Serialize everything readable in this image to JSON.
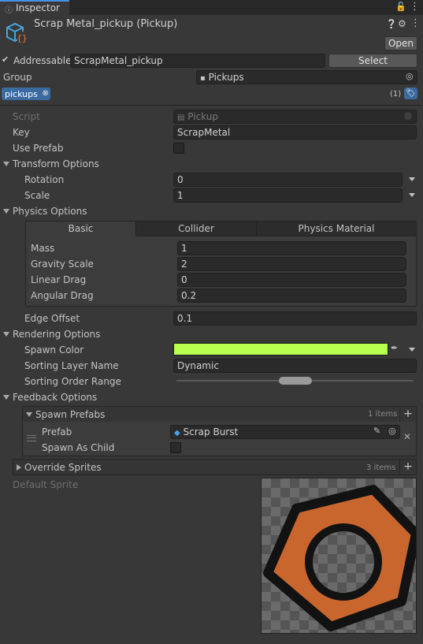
{
  "tab": {
    "label": "Inspector"
  },
  "header": {
    "title": "Scrap Metal_pickup (Pickup)",
    "open_label": "Open"
  },
  "addressable": {
    "label": "Addressable",
    "address": "ScrapMetal_pickup",
    "select_label": "Select",
    "group_label": "Group",
    "group_value": "Pickups",
    "tag": "pickups",
    "tag_count": "(1)"
  },
  "fields": {
    "script_label": "Script",
    "script_value": "Pickup",
    "key_label": "Key",
    "key_value": "ScrapMetal",
    "use_prefab_label": "Use Prefab",
    "transform_options": "Transform Options",
    "rotation_label": "Rotation",
    "rotation_value": "0",
    "scale_label": "Scale",
    "scale_value": "1",
    "physics_options": "Physics Options",
    "physics_tabs": [
      "Basic",
      "Collider",
      "Physics Material"
    ],
    "mass_label": "Mass",
    "mass_value": "1",
    "gravity_label": "Gravity Scale",
    "gravity_value": "2",
    "linear_drag_label": "Linear Drag",
    "linear_drag_value": "0",
    "angular_drag_label": "Angular Drag",
    "angular_drag_value": "0.2",
    "edge_offset_label": "Edge Offset",
    "edge_offset_value": "0.1",
    "rendering_options": "Rendering Options",
    "spawn_color_label": "Spawn Color",
    "spawn_color": "#b9ff4f",
    "sorting_layer_label": "Sorting Layer Name",
    "sorting_layer_value": "Dynamic",
    "sorting_order_label": "Sorting Order Range",
    "feedback_options": "Feedback Options",
    "spawn_prefabs_label": "Spawn Prefabs",
    "spawn_prefabs_count": "1 items",
    "prefab_label": "Prefab",
    "prefab_value": "Scrap Burst",
    "spawn_as_child_label": "Spawn As Child",
    "override_sprites_label": "Override Sprites",
    "override_sprites_count": "3 items",
    "default_sprite_label": "Default Sprite"
  },
  "colors": {
    "panel": "#383838",
    "field": "#2a2a2a",
    "tag": "#3b6aa0",
    "sprite_orange": "#c8662e"
  },
  "icons": [
    "lock-icon",
    "menu-icon",
    "help-icon",
    "settings-icon",
    "more-icon",
    "prefab-cube-icon",
    "tag-icon",
    "eyedropper-icon",
    "pencil-icon",
    "target-icon"
  ]
}
